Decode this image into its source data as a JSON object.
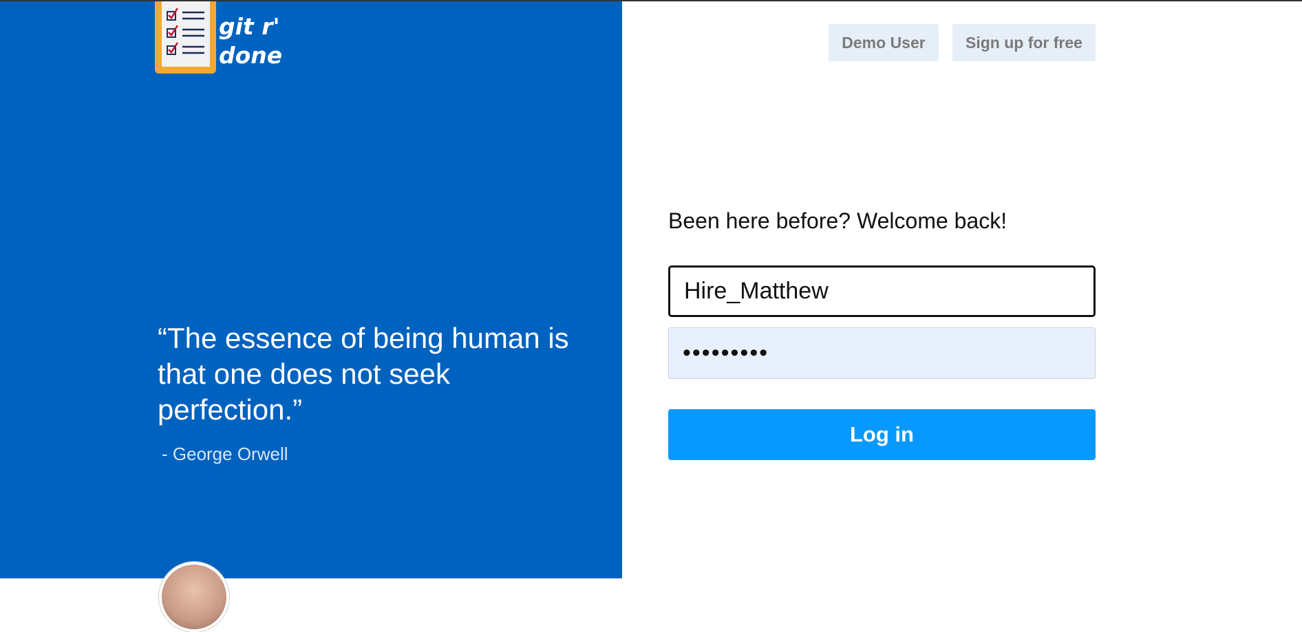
{
  "brand": {
    "logo_line1": "git r'",
    "logo_line2": "done",
    "logo_icon": "clipboard-checklist-icon"
  },
  "quote": {
    "text": "“The essence of being human is that one does not seek perfection.”",
    "author": "- George Orwell"
  },
  "header": {
    "demo_label": "Demo User",
    "signup_label": "Sign up for free"
  },
  "login": {
    "welcome": "Been here before? Welcome back!",
    "username_value": "Hire_Matthew",
    "password_value": "123456789",
    "submit_label": "Log in"
  },
  "colors": {
    "panel_blue": "#0062bf",
    "button_blue": "#0799ff",
    "nav_button_bg": "#e6eef7",
    "logo_orange": "#f3a833"
  }
}
